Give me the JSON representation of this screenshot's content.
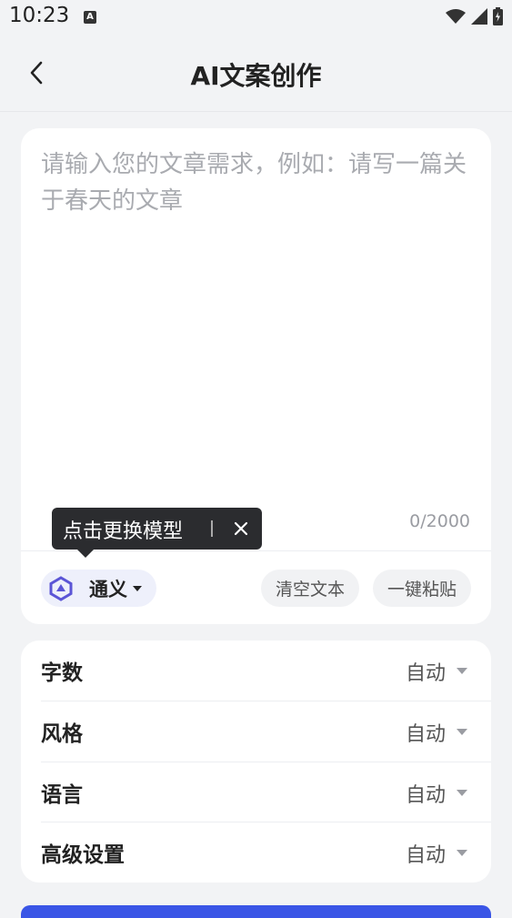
{
  "status_bar": {
    "time": "10:23",
    "notification_letter": "A"
  },
  "header": {
    "title": "AI文案创作"
  },
  "editor": {
    "placeholder": "请输入您的文章需求，例如：请写一篇关于春天的文章",
    "char_count": "0/2000"
  },
  "model": {
    "name": "通义"
  },
  "tooltip": {
    "text": "点击更换模型"
  },
  "actions": {
    "clear_label": "清空文本",
    "paste_label": "一键粘贴"
  },
  "settings": {
    "rows": [
      {
        "label": "字数",
        "value": "自动"
      },
      {
        "label": "风格",
        "value": "自动"
      },
      {
        "label": "语言",
        "value": "自动"
      },
      {
        "label": "高级设置",
        "value": "自动"
      }
    ]
  },
  "colors": {
    "accent": "#3a55e6",
    "background": "#f2f3f5",
    "placeholder": "#a9abb0"
  }
}
